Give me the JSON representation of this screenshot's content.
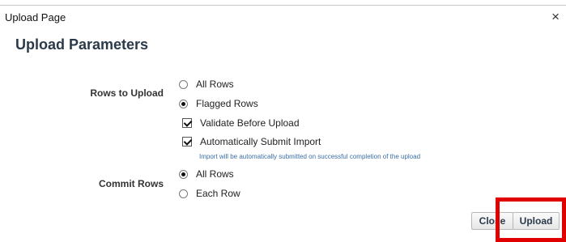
{
  "dialog": {
    "title": "Upload Page",
    "close_glyph": "×",
    "heading": "Upload Parameters"
  },
  "rows_to_upload": {
    "label": "Rows to Upload",
    "options": [
      {
        "label": "All Rows",
        "selected": false
      },
      {
        "label": "Flagged Rows",
        "selected": true
      }
    ]
  },
  "options": {
    "validate_label": "Validate Before Upload",
    "validate_checked": true,
    "auto_submit_label": "Automatically Submit Import",
    "auto_submit_checked": true,
    "auto_submit_hint": "Import will be automatically submitted on successful completion of the upload"
  },
  "commit_rows": {
    "label": "Commit Rows",
    "options": [
      {
        "label": "All Rows",
        "selected": true
      },
      {
        "label": "Each Row",
        "selected": false
      }
    ]
  },
  "footer": {
    "close_label": "Close",
    "upload_label": "Upload"
  },
  "colors": {
    "highlight": "#e00000",
    "heading": "#2b3a4a",
    "hint": "#3b6ea5"
  },
  "icons": {
    "close": "close-icon",
    "radio": "radio-button",
    "checkbox": "checkbox"
  }
}
